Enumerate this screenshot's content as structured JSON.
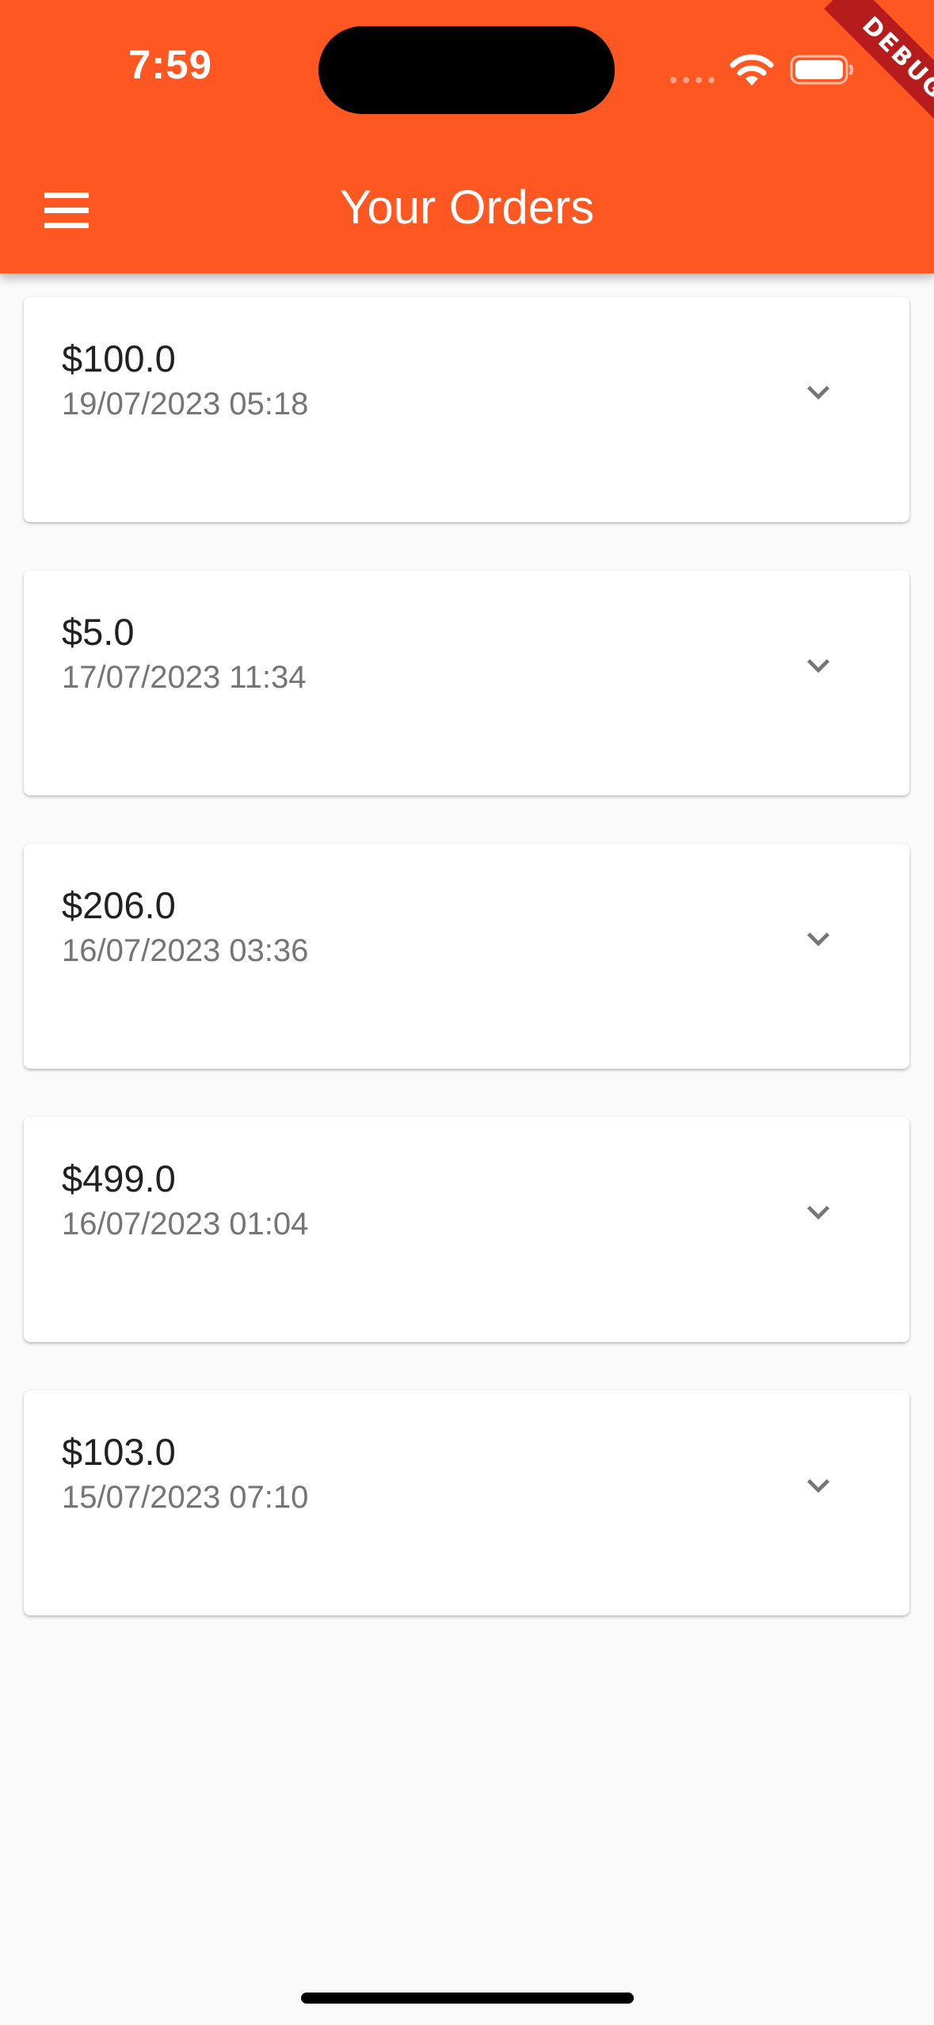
{
  "status_bar": {
    "time": "7:59",
    "debug_label": "DEBUG"
  },
  "app_bar": {
    "title": "Your Orders",
    "color": "#ff5722",
    "menu_icon": "menu-icon"
  },
  "orders": [
    {
      "amount": "$100.0",
      "date": "19/07/2023 05:18"
    },
    {
      "amount": "$5.0",
      "date": "17/07/2023 11:34"
    },
    {
      "amount": "$206.0",
      "date": "16/07/2023 03:36"
    },
    {
      "amount": "$499.0",
      "date": "16/07/2023 01:04"
    },
    {
      "amount": "$103.0",
      "date": "15/07/2023 07:10"
    }
  ]
}
